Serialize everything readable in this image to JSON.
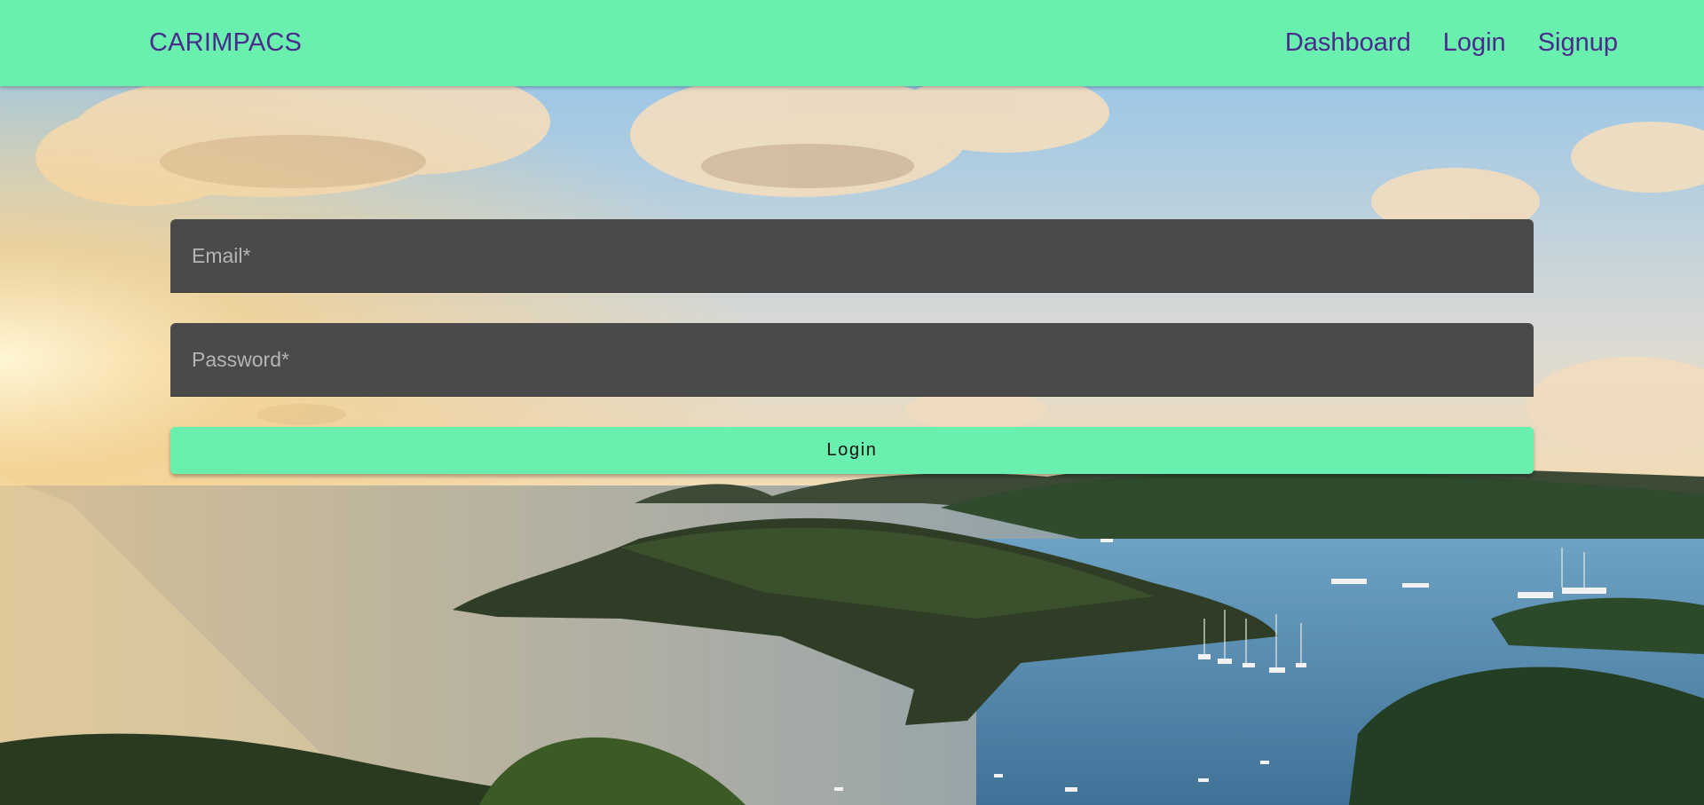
{
  "navbar": {
    "brand": "CARIMPACS",
    "links": [
      {
        "label": "Dashboard"
      },
      {
        "label": "Login"
      },
      {
        "label": "Signup"
      }
    ]
  },
  "login_form": {
    "email_placeholder": "Email*",
    "email_value": "",
    "password_placeholder": "Password*",
    "password_value": "",
    "submit_label": "Login"
  },
  "colors": {
    "navbar_bg": "#69f0ae",
    "brand_text": "#4a2a8c",
    "input_bg": "#4a4a4a",
    "button_bg": "#69f0ae"
  }
}
